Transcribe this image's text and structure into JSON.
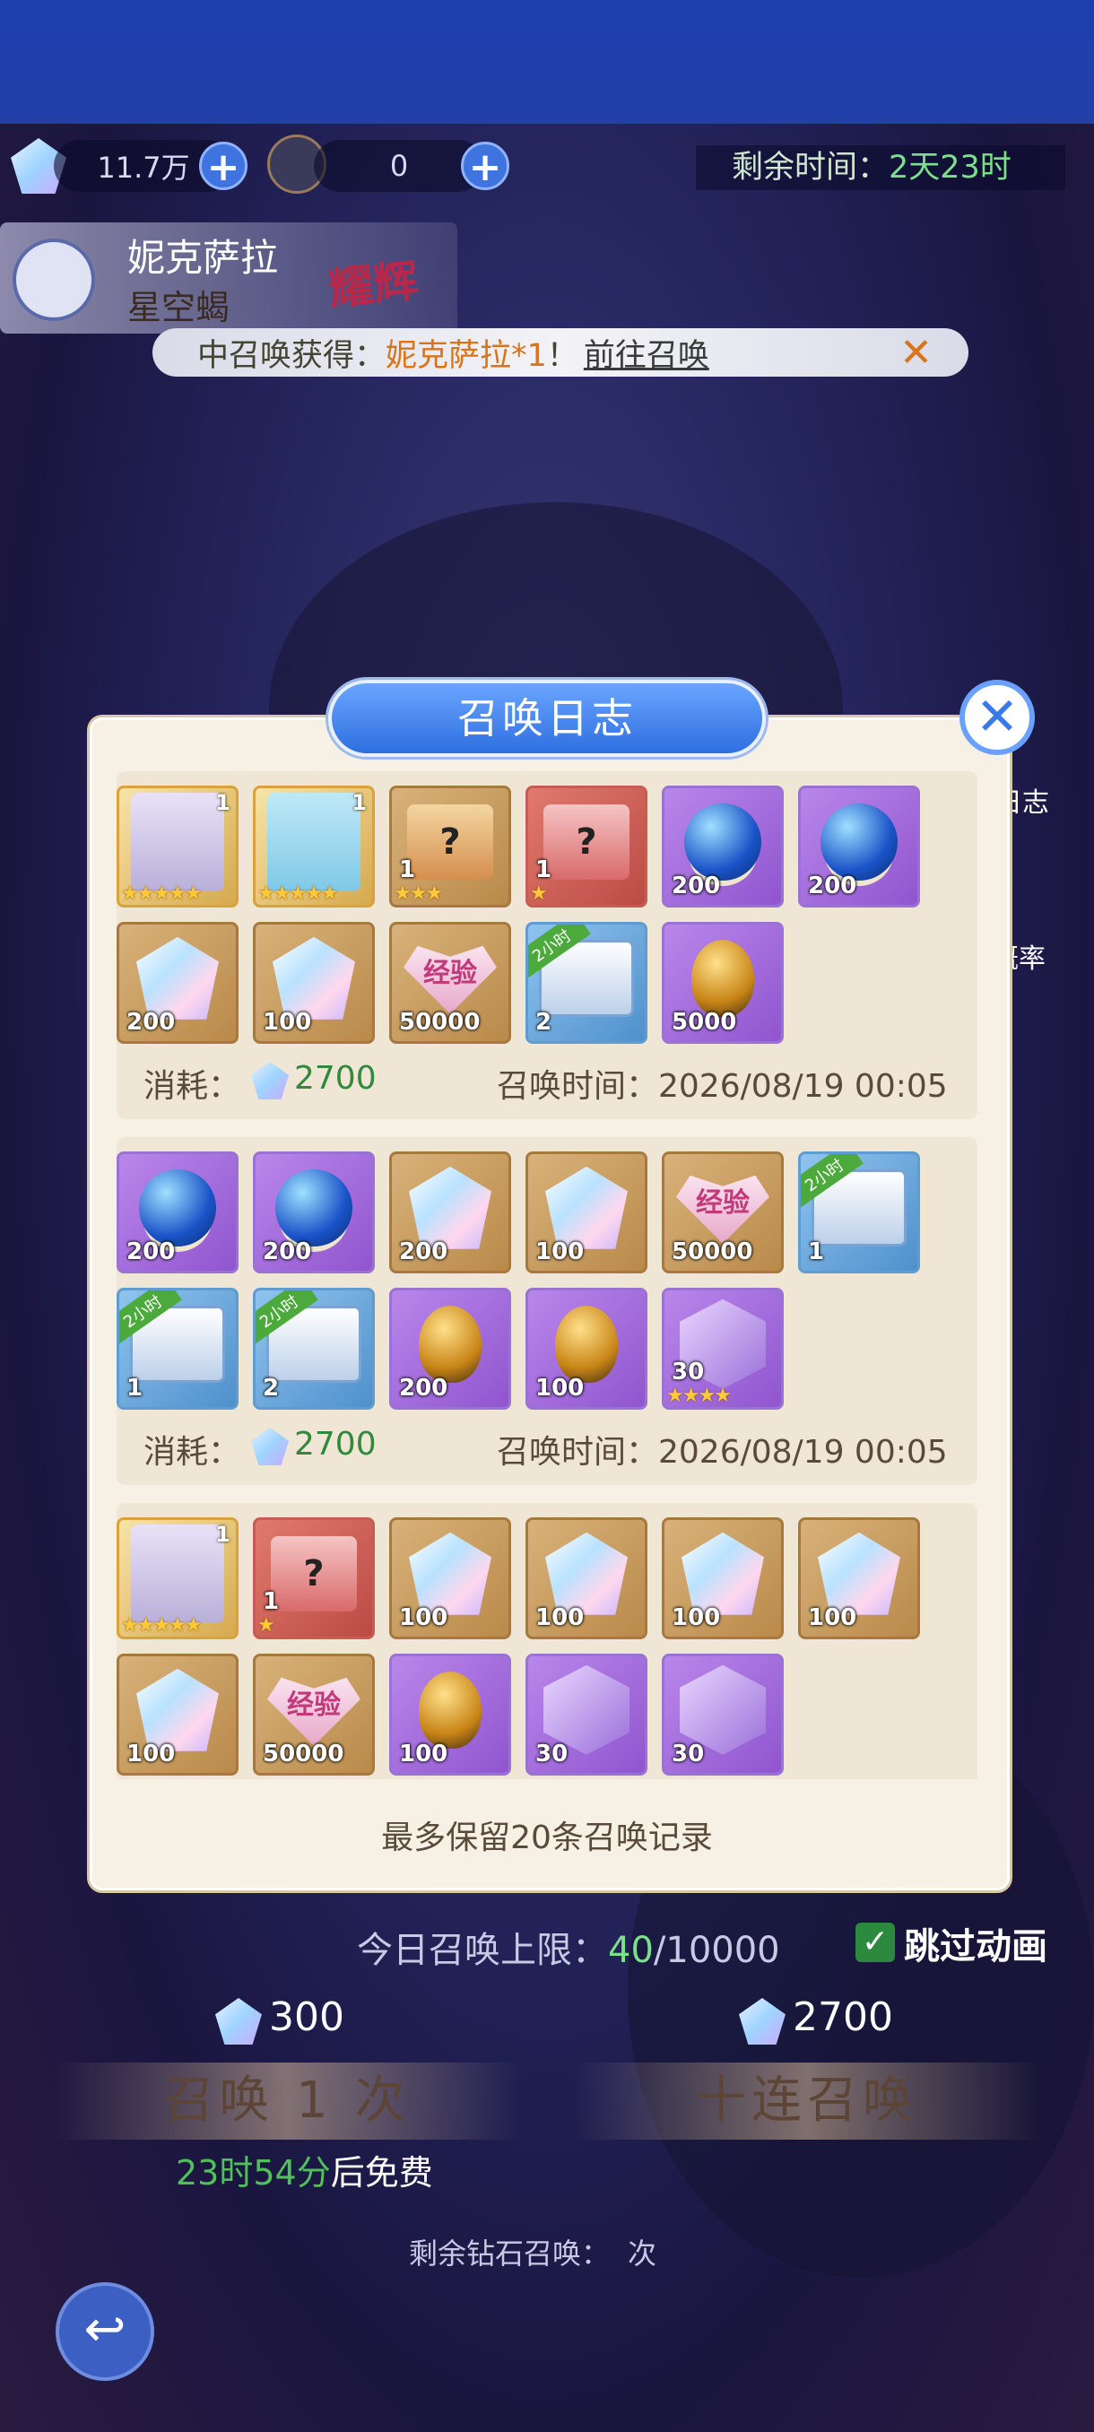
{
  "resources": {
    "diamond_amount": "11.7万",
    "ticket_amount": "0",
    "remaining_time_label": "剩余时间：",
    "remaining_time_value": "2天23时"
  },
  "featured_hero": {
    "name": "妮克萨拉",
    "title": "星空蝎",
    "badge": "耀辉"
  },
  "notice": {
    "prefix": "中召唤获得：",
    "item": "妮克萨拉*1",
    "sep": "！",
    "link": "前往召唤"
  },
  "side_buttons": {
    "log": "日志",
    "rate": "概率"
  },
  "dialog": {
    "title": "召唤日志",
    "footer": "最多保留20条召唤记录",
    "groups": [
      {
        "cost_label": "消耗：",
        "cost": "2700",
        "time_label": "召唤时间：",
        "time": "2026/08/19 00:05",
        "items": [
          {
            "kind": "portrait-w",
            "bg": "gold",
            "lvl": "1",
            "stars": "★★★★★",
            "qty": ""
          },
          {
            "kind": "portrait-b",
            "bg": "gold",
            "lvl": "1",
            "stars": "★★★★★",
            "qty": ""
          },
          {
            "kind": "box-q",
            "bg": "tan",
            "lvl": "",
            "stars": "★★★",
            "qty": "1"
          },
          {
            "kind": "box-r",
            "bg": "red",
            "lvl": "",
            "stars": "★",
            "qty": "1"
          },
          {
            "kind": "orb",
            "bg": "purple",
            "lvl": "",
            "stars": "",
            "qty": "200"
          },
          {
            "kind": "orb",
            "bg": "purple",
            "lvl": "",
            "stars": "",
            "qty": "200"
          },
          {
            "kind": "crystal",
            "bg": "tan",
            "lvl": "",
            "stars": "",
            "qty": "200"
          },
          {
            "kind": "crystal",
            "bg": "tan",
            "lvl": "",
            "stars": "",
            "qty": "100"
          },
          {
            "kind": "heart",
            "bg": "tan",
            "lvl": "",
            "stars": "",
            "qty": "50000",
            "text": "经验"
          },
          {
            "kind": "chest",
            "bg": "blue",
            "lvl": "",
            "stars": "",
            "qty": "2",
            "tag": "2小时"
          },
          {
            "kind": "egg",
            "bg": "purple",
            "lvl": "",
            "stars": "",
            "qty": "5000"
          }
        ]
      },
      {
        "cost_label": "消耗：",
        "cost": "2700",
        "time_label": "召唤时间：",
        "time": "2026/08/19 00:05",
        "items": [
          {
            "kind": "orb",
            "bg": "purple",
            "lvl": "",
            "stars": "",
            "qty": "200"
          },
          {
            "kind": "orb",
            "bg": "purple",
            "lvl": "",
            "stars": "",
            "qty": "200"
          },
          {
            "kind": "crystal",
            "bg": "tan",
            "lvl": "",
            "stars": "",
            "qty": "200"
          },
          {
            "kind": "crystal",
            "bg": "tan",
            "lvl": "",
            "stars": "",
            "qty": "100"
          },
          {
            "kind": "heart",
            "bg": "tan",
            "lvl": "",
            "stars": "",
            "qty": "50000",
            "text": "经验"
          },
          {
            "kind": "chest",
            "bg": "blue",
            "lvl": "",
            "stars": "",
            "qty": "1",
            "tag": "2小时"
          },
          {
            "kind": "chest",
            "bg": "blue",
            "lvl": "",
            "stars": "",
            "qty": "1",
            "tag": "2小时"
          },
          {
            "kind": "chest",
            "bg": "blue",
            "lvl": "",
            "stars": "",
            "qty": "2",
            "tag": "2小时"
          },
          {
            "kind": "egg",
            "bg": "purple",
            "lvl": "",
            "stars": "",
            "qty": "200"
          },
          {
            "kind": "egg",
            "bg": "purple",
            "lvl": "",
            "stars": "",
            "qty": "100"
          },
          {
            "kind": "cube",
            "bg": "purple",
            "lvl": "",
            "stars": "★★★★",
            "qty": "30"
          }
        ]
      },
      {
        "cost_label": "",
        "cost": "",
        "time_label": "",
        "time": "",
        "items": [
          {
            "kind": "portrait-w",
            "bg": "gold",
            "lvl": "1",
            "stars": "★★★★★",
            "qty": ""
          },
          {
            "kind": "box-r",
            "bg": "red",
            "lvl": "",
            "stars": "★",
            "qty": "1"
          },
          {
            "kind": "crystal",
            "bg": "tan",
            "lvl": "",
            "stars": "",
            "qty": "100"
          },
          {
            "kind": "crystal",
            "bg": "tan",
            "lvl": "",
            "stars": "",
            "qty": "100"
          },
          {
            "kind": "crystal",
            "bg": "tan",
            "lvl": "",
            "stars": "",
            "qty": "100"
          },
          {
            "kind": "crystal",
            "bg": "tan",
            "lvl": "",
            "stars": "",
            "qty": "100"
          },
          {
            "kind": "crystal",
            "bg": "tan",
            "lvl": "",
            "stars": "",
            "qty": "100"
          },
          {
            "kind": "heart",
            "bg": "tan",
            "lvl": "",
            "stars": "",
            "qty": "50000",
            "text": "经验"
          },
          {
            "kind": "egg",
            "bg": "purple",
            "lvl": "",
            "stars": "",
            "qty": "100"
          },
          {
            "kind": "cube",
            "bg": "purple",
            "lvl": "",
            "stars": "",
            "qty": "30"
          },
          {
            "kind": "cube",
            "bg": "purple",
            "lvl": "",
            "stars": "",
            "qty": "30"
          }
        ]
      }
    ]
  },
  "bottom": {
    "daily_limit_label": "今日召唤上限：",
    "daily_limit_used": "40",
    "daily_limit_total": "/10000",
    "skip_anim": "跳过动画",
    "single_cost": "300",
    "ten_cost": "2700",
    "single_button": "召唤 1 次",
    "ten_button": "十连召唤",
    "free_timer": "23时54分",
    "free_suffix": "后免费",
    "remaining_diamond_label": "剩余钻石召唤：",
    "remaining_diamond_value": "",
    "remaining_diamond_unit": "次"
  },
  "colors": {
    "accent_blue": "#2e6fe0",
    "cost_green": "#2f8a3a",
    "notice_orange": "#d8741a",
    "panel_bg": "#f7f0e4"
  }
}
